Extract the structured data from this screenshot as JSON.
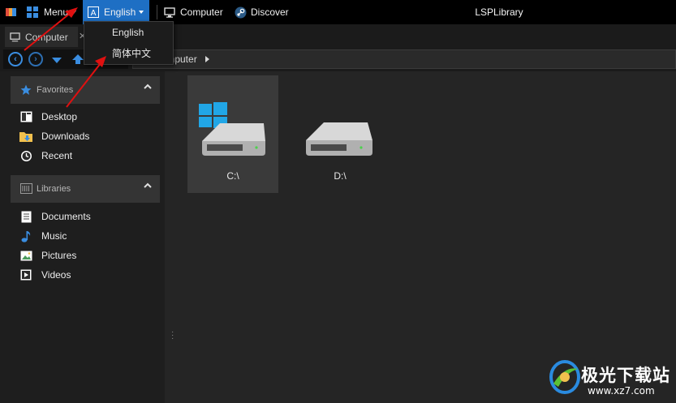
{
  "topbar": {
    "menu_label": "Menu",
    "language_label": "English",
    "computer_label": "Computer",
    "discover_label": "Discover",
    "title": "LSPLibrary"
  },
  "language_dropdown": {
    "options": [
      "English",
      "简体中文"
    ]
  },
  "tab": {
    "label": "Computer"
  },
  "address": {
    "path": "Computer"
  },
  "sidebar": {
    "favorites": {
      "header": "Favorites",
      "items": [
        {
          "label": "Desktop",
          "icon": "desktop-icon"
        },
        {
          "label": "Downloads",
          "icon": "downloads-folder-icon"
        },
        {
          "label": "Recent",
          "icon": "clock-icon"
        }
      ]
    },
    "libraries": {
      "header": "Libraries",
      "items": [
        {
          "label": "Documents",
          "icon": "document-icon"
        },
        {
          "label": "Music",
          "icon": "music-note-icon"
        },
        {
          "label": "Pictures",
          "icon": "picture-icon"
        },
        {
          "label": "Videos",
          "icon": "video-icon"
        }
      ]
    }
  },
  "drives": [
    {
      "label": "C:\\",
      "selected": true,
      "system": true
    },
    {
      "label": "D:\\",
      "selected": false,
      "system": false
    }
  ],
  "watermark": {
    "brand": "极光下载站",
    "url": "www.xz7.com"
  },
  "colors": {
    "accent": "#1e6fc4",
    "background": "#252525",
    "sidebar": "#1e1e1e",
    "annotation_arrow": "#e01010"
  }
}
